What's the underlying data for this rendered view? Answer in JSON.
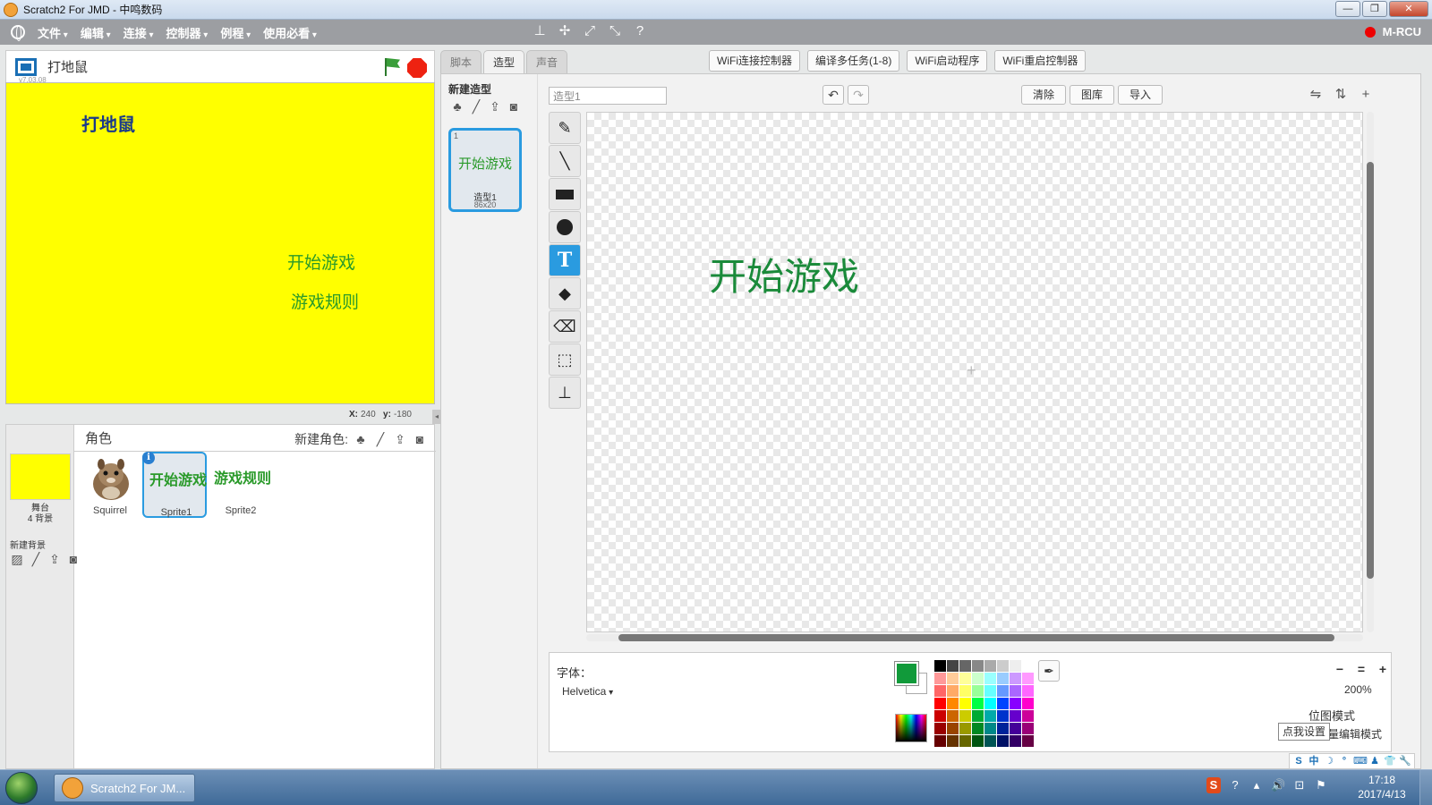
{
  "window": {
    "title": "Scratch2 For JMD - 中鸣数码",
    "min_label": "—",
    "max_label": "❐",
    "close_label": "✕"
  },
  "menu": {
    "items": [
      "文件",
      "编辑",
      "连接",
      "控制器",
      "例程",
      "使用必看"
    ],
    "tool_icons": [
      "stamp-icon",
      "move-icon",
      "grow-icon",
      "shrink-icon",
      "help-icon"
    ],
    "tool_glyphs": [
      "⊥",
      "✢",
      "⤢",
      "⤡",
      "?"
    ],
    "device": "M-RCU",
    "device_status_color": "#ee0000"
  },
  "stage": {
    "project_name": "打地鼠",
    "version": "v7.03.08",
    "background_color": "#ffff00",
    "texts": [
      "打地鼠",
      "开始游戏",
      "游戏规则"
    ],
    "coords": {
      "x_label": "X:",
      "x": "240",
      "y_label": "y:",
      "y": "-180"
    },
    "collapse_glyph": "◂"
  },
  "sprites": {
    "header": "角色",
    "new_sprite_label": "新建角色:",
    "new_sprite_icons": [
      "sprite-library-icon",
      "paint-new-icon",
      "upload-icon",
      "camera-icon"
    ],
    "new_sprite_glyphs": [
      "♣",
      "╱",
      "⇪",
      "◙"
    ],
    "stage_thumb_label": "舞台",
    "stage_thumb_sub": "4 背景",
    "new_backdrop_label": "新建背景",
    "backdrop_glyphs": [
      "▨",
      "╱",
      "⇪",
      "◙"
    ],
    "list": [
      {
        "name": "Squirrel",
        "thumb_text": ""
      },
      {
        "name": "Sprite1",
        "thumb_text": "开始游戏",
        "selected": true,
        "info": "i"
      },
      {
        "name": "Sprite2",
        "thumb_text": "游戏规则"
      }
    ]
  },
  "tabs": [
    {
      "label": "脚本",
      "active": false
    },
    {
      "label": "造型",
      "active": true
    },
    {
      "label": "声音",
      "active": false
    }
  ],
  "wifi_buttons": [
    "WiFi连接控制器",
    "编译多任务(1-8)",
    "WiFi启动程序",
    "WiFi重启控制器"
  ],
  "costumes": {
    "header": "新建造型",
    "new_glyphs": [
      "♣",
      "╱",
      "⇪",
      "◙"
    ],
    "list": [
      {
        "num": "1",
        "text": "开始游戏",
        "name": "造型1",
        "size": "86x20"
      }
    ]
  },
  "paint": {
    "costume_name": "造型1",
    "undo_glyph": "↶",
    "redo_glyph": "↷",
    "buttons": [
      "清除",
      "图库",
      "导入"
    ],
    "right_icons": [
      "flip-horizontal-icon",
      "flip-vertical-icon",
      "set-center-icon"
    ],
    "right_glyphs": [
      "⇋",
      "⇅",
      "+"
    ],
    "tools": [
      {
        "name": "brush-tool",
        "glyph": "✎"
      },
      {
        "name": "line-tool",
        "glyph": "╲"
      },
      {
        "name": "rectangle-tool",
        "glyph": ""
      },
      {
        "name": "ellipse-tool",
        "glyph": ""
      },
      {
        "name": "text-tool",
        "glyph": "T",
        "active": true
      },
      {
        "name": "fill-tool",
        "glyph": "◆"
      },
      {
        "name": "eraser-tool",
        "glyph": "⌫"
      },
      {
        "name": "select-tool",
        "glyph": "⬚"
      },
      {
        "name": "stamp-tool",
        "glyph": "⊥"
      }
    ],
    "canvas_text": "开始游戏",
    "crosshair": "+",
    "font_label": "字体：",
    "font_value": "Helvetica",
    "current_color": "#119a3a",
    "eyedropper_glyph": "✒",
    "zoom": {
      "out": "🔍",
      "reset": "=",
      "in": "🔍",
      "value": "200%"
    },
    "mode_bitmap": "位图模式",
    "mode_vector": "矢量编辑模式",
    "tooltip": "点我设置",
    "palette": [
      "#000000",
      "#444444",
      "#666666",
      "#888888",
      "#aaaaaa",
      "#cccccc",
      "#eeeeee",
      "#ffffff",
      "#ff9999",
      "#ffcc99",
      "#ffff99",
      "#ccffcc",
      "#99ffff",
      "#99ccff",
      "#cc99ff",
      "#ff99ff",
      "#ff6666",
      "#ffaa66",
      "#ffff66",
      "#99ff99",
      "#66ffff",
      "#6699ff",
      "#aa66ff",
      "#ff66ff",
      "#ff0000",
      "#ff8800",
      "#ffff00",
      "#00ff44",
      "#00ffff",
      "#0044ff",
      "#8800ff",
      "#ff00cc",
      "#cc0000",
      "#cc6600",
      "#cccc00",
      "#00aa33",
      "#00aaaa",
      "#0033cc",
      "#6600cc",
      "#cc0099",
      "#990000",
      "#994400",
      "#999900",
      "#008822",
      "#008888",
      "#002299",
      "#440099",
      "#990077",
      "#660000",
      "#663300",
      "#666600",
      "#005511",
      "#005555",
      "#001166",
      "#330066",
      "#660044"
    ]
  },
  "ime": [
    "S",
    "中",
    "☽",
    "°",
    "⌨",
    "♟",
    "👕",
    "🔧"
  ],
  "taskbar": {
    "task_label": "Scratch2 For JM...",
    "tray_glyphs": [
      "S",
      "?",
      "▴",
      "🔊",
      "⊡",
      "⚑"
    ],
    "time": "17:18",
    "date": "2017/4/13"
  }
}
